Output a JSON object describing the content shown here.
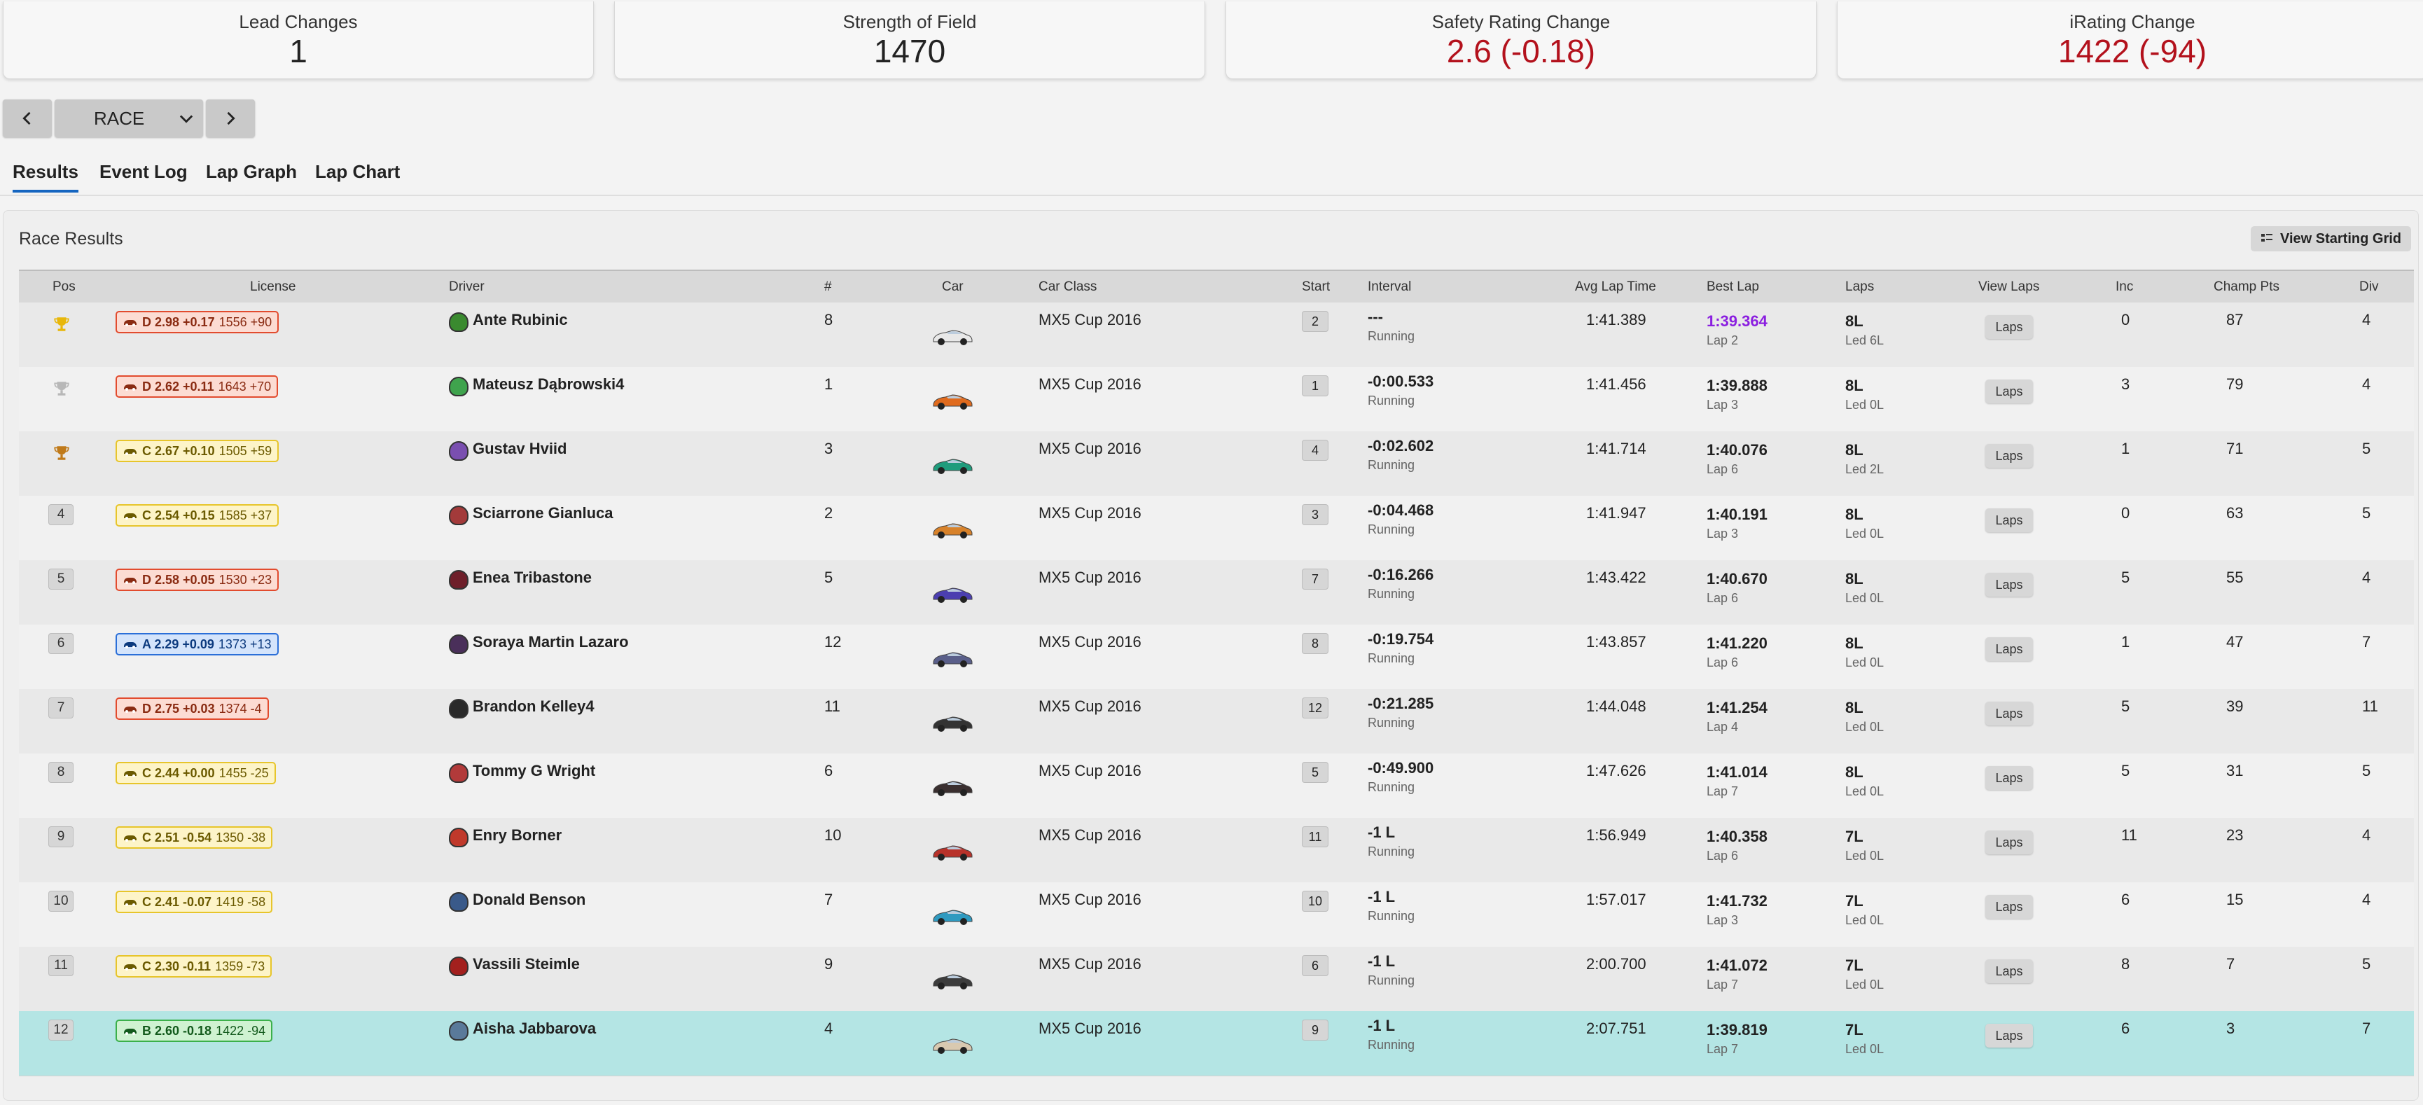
{
  "stats": [
    {
      "label": "Lead Changes",
      "value": "1",
      "color": "#222222"
    },
    {
      "label": "Strength of Field",
      "value": "1470",
      "color": "#222222"
    },
    {
      "label": "Safety Rating Change",
      "value": "2.6 (-0.18)",
      "color": "#b3111c"
    },
    {
      "label": "iRating Change",
      "value": "1422 (-94)",
      "color": "#b3111c"
    }
  ],
  "session_selector": {
    "label": "RACE",
    "prev_icon": "chevron-left-icon",
    "next_icon": "chevron-right-icon",
    "dropdown_icon": "chevron-down-icon"
  },
  "tabs": [
    {
      "label": "Results",
      "active": true
    },
    {
      "label": "Event Log",
      "active": false
    },
    {
      "label": "Lap Graph",
      "active": false
    },
    {
      "label": "Lap Chart",
      "active": false
    }
  ],
  "panel": {
    "title": "Race Results",
    "grid_button": "View Starting Grid",
    "grid_icon": "grid-icon"
  },
  "columns": [
    "Pos",
    "License",
    "Driver",
    "#",
    "Car",
    "Car Class",
    "Start",
    "Interval",
    "Avg Lap Time",
    "Best Lap",
    "Laps",
    "View Laps",
    "Inc",
    "Champ Pts",
    "Div"
  ],
  "rows": [
    {
      "pos": "1",
      "trophy": "gold",
      "lic_class": "D",
      "lic_main": "D 2.98 +0.17",
      "lic_ir": "1556 +90",
      "driver": "Ante Rubinic",
      "helmet": "#3a8a2f",
      "num": "8",
      "car": "#e8e8e8",
      "car_class": "MX5 Cup 2016",
      "start": "2",
      "interval": "---",
      "status": "Running",
      "avg": "1:41.389",
      "best": "1:39.364",
      "best_lap": "Lap 2",
      "best_highlight": true,
      "laps": "8L",
      "led": "Led 6L",
      "view_laps": "Laps",
      "inc": "0",
      "champ": "87",
      "div": "4"
    },
    {
      "pos": "2",
      "trophy": "silver",
      "lic_class": "D",
      "lic_main": "D 2.62 +0.11",
      "lic_ir": "1643 +70",
      "driver": "Mateusz Dąbrowski4",
      "helmet": "#3fa34d",
      "num": "1",
      "car": "#e06b1e",
      "car_class": "MX5 Cup 2016",
      "start": "1",
      "interval": "-0:00.533",
      "status": "Running",
      "avg": "1:41.456",
      "best": "1:39.888",
      "best_lap": "Lap 3",
      "best_highlight": false,
      "laps": "8L",
      "led": "Led 0L",
      "view_laps": "Laps",
      "inc": "3",
      "champ": "79",
      "div": "4"
    },
    {
      "pos": "3",
      "trophy": "bronze",
      "lic_class": "C",
      "lic_main": "C 2.67 +0.10",
      "lic_ir": "1505 +59",
      "driver": "Gustav Hviid",
      "helmet": "#7a4fb0",
      "num": "3",
      "car": "#1f9c7c",
      "car_class": "MX5 Cup 2016",
      "start": "4",
      "interval": "-0:02.602",
      "status": "Running",
      "avg": "1:41.714",
      "best": "1:40.076",
      "best_lap": "Lap 6",
      "best_highlight": false,
      "laps": "8L",
      "led": "Led 2L",
      "view_laps": "Laps",
      "inc": "1",
      "champ": "71",
      "div": "5"
    },
    {
      "pos": "4",
      "trophy": "",
      "lic_class": "C",
      "lic_main": "C 2.54 +0.15",
      "lic_ir": "1585 +37",
      "driver": "Sciarrone Gianluca",
      "helmet": "#a33a3a",
      "num": "2",
      "car": "#d8822a",
      "car_class": "MX5 Cup 2016",
      "start": "3",
      "interval": "-0:04.468",
      "status": "Running",
      "avg": "1:41.947",
      "best": "1:40.191",
      "best_lap": "Lap 3",
      "best_highlight": false,
      "laps": "8L",
      "led": "Led 0L",
      "view_laps": "Laps",
      "inc": "0",
      "champ": "63",
      "div": "5"
    },
    {
      "pos": "5",
      "trophy": "",
      "lic_class": "D",
      "lic_main": "D 2.58 +0.05",
      "lic_ir": "1530 +23",
      "driver": "Enea Tribastone",
      "helmet": "#6e1f2a",
      "num": "5",
      "car": "#4b3fb0",
      "car_class": "MX5 Cup 2016",
      "start": "7",
      "interval": "-0:16.266",
      "status": "Running",
      "avg": "1:43.422",
      "best": "1:40.670",
      "best_lap": "Lap 6",
      "best_highlight": false,
      "laps": "8L",
      "led": "Led 0L",
      "view_laps": "Laps",
      "inc": "5",
      "champ": "55",
      "div": "4"
    },
    {
      "pos": "6",
      "trophy": "",
      "lic_class": "A",
      "lic_main": "A 2.29 +0.09",
      "lic_ir": "1373 +13",
      "driver": "Soraya Martin Lazaro",
      "helmet": "#4a2f5a",
      "num": "12",
      "car": "#5a5f8a",
      "car_class": "MX5 Cup 2016",
      "start": "8",
      "interval": "-0:19.754",
      "status": "Running",
      "avg": "1:43.857",
      "best": "1:41.220",
      "best_lap": "Lap 6",
      "best_highlight": false,
      "laps": "8L",
      "led": "Led 0L",
      "view_laps": "Laps",
      "inc": "1",
      "champ": "47",
      "div": "7"
    },
    {
      "pos": "7",
      "trophy": "",
      "lic_class": "D",
      "lic_main": "D 2.75 +0.03",
      "lic_ir": "1374 -4",
      "driver": "Brandon Kelley4",
      "helmet": "#2a2a2a",
      "num": "11",
      "car": "#333333",
      "car_class": "MX5 Cup 2016",
      "start": "12",
      "interval": "-0:21.285",
      "status": "Running",
      "avg": "1:44.048",
      "best": "1:41.254",
      "best_lap": "Lap 4",
      "best_highlight": false,
      "laps": "8L",
      "led": "Led 0L",
      "view_laps": "Laps",
      "inc": "5",
      "champ": "39",
      "div": "11"
    },
    {
      "pos": "8",
      "trophy": "",
      "lic_class": "C",
      "lic_main": "C 2.44 +0.00",
      "lic_ir": "1455 -25",
      "driver": "Tommy G Wright",
      "helmet": "#b23a3a",
      "num": "6",
      "car": "#3a2f2f",
      "car_class": "MX5 Cup 2016",
      "start": "5",
      "interval": "-0:49.900",
      "status": "Running",
      "avg": "1:47.626",
      "best": "1:41.014",
      "best_lap": "Lap 7",
      "best_highlight": false,
      "laps": "8L",
      "led": "Led 0L",
      "view_laps": "Laps",
      "inc": "5",
      "champ": "31",
      "div": "5"
    },
    {
      "pos": "9",
      "trophy": "",
      "lic_class": "C",
      "lic_main": "C 2.51 -0.54",
      "lic_ir": "1350 -38",
      "driver": "Enry Borner",
      "helmet": "#c0392b",
      "num": "10",
      "car": "#b8322a",
      "car_class": "MX5 Cup 2016",
      "start": "11",
      "interval": "-1 L",
      "status": "Running",
      "avg": "1:56.949",
      "best": "1:40.358",
      "best_lap": "Lap 6",
      "best_highlight": false,
      "laps": "7L",
      "led": "Led 0L",
      "view_laps": "Laps",
      "inc": "11",
      "champ": "23",
      "div": "4"
    },
    {
      "pos": "10",
      "trophy": "",
      "lic_class": "C",
      "lic_main": "C 2.41 -0.07",
      "lic_ir": "1419 -58",
      "driver": "Donald Benson",
      "helmet": "#3a5a8a",
      "num": "7",
      "car": "#2f9ac0",
      "car_class": "MX5 Cup 2016",
      "start": "10",
      "interval": "-1 L",
      "status": "Running",
      "avg": "1:57.017",
      "best": "1:41.732",
      "best_lap": "Lap 3",
      "best_highlight": false,
      "laps": "7L",
      "led": "Led 0L",
      "view_laps": "Laps",
      "inc": "6",
      "champ": "15",
      "div": "4"
    },
    {
      "pos": "11",
      "trophy": "",
      "lic_class": "C",
      "lic_main": "C 2.30 -0.11",
      "lic_ir": "1359 -73",
      "driver": "Vassili Steimle",
      "helmet": "#a3201e",
      "num": "9",
      "car": "#3c3c3c",
      "car_class": "MX5 Cup 2016",
      "start": "6",
      "interval": "-1 L",
      "status": "Running",
      "avg": "2:00.700",
      "best": "1:41.072",
      "best_lap": "Lap 7",
      "best_highlight": false,
      "laps": "7L",
      "led": "Led 0L",
      "view_laps": "Laps",
      "inc": "8",
      "champ": "7",
      "div": "5"
    },
    {
      "pos": "12",
      "trophy": "",
      "lic_class": "B",
      "lic_main": "B 2.60 -0.18",
      "lic_ir": "1422 -94",
      "driver": "Aisha Jabbarova",
      "helmet": "#5a7a9a",
      "num": "4",
      "car": "#d9c9b0",
      "car_class": "MX5 Cup 2016",
      "start": "9",
      "interval": "-1 L",
      "status": "Running",
      "avg": "2:07.751",
      "best": "1:39.819",
      "best_lap": "Lap 7",
      "best_highlight": false,
      "laps": "7L",
      "led": "Led 0L",
      "view_laps": "Laps",
      "inc": "6",
      "champ": "3",
      "div": "7",
      "self": true
    }
  ]
}
